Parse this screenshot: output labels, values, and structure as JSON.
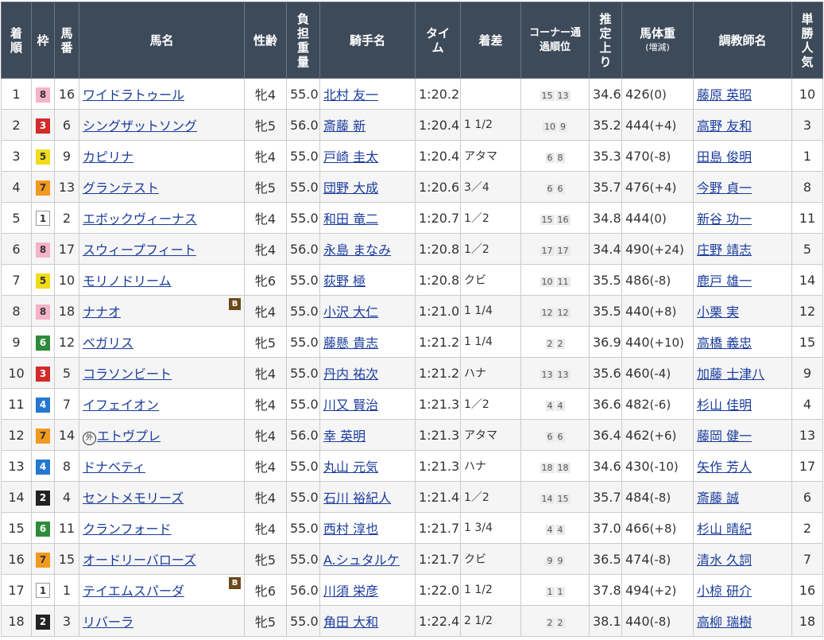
{
  "headers": {
    "rank": "着順",
    "waku": "枠",
    "umaban": "馬番",
    "horse": "馬名",
    "sexage": "性齢",
    "weight": "負担重量",
    "jockey": "騎手名",
    "time": "タイム",
    "margin": "着差",
    "corner": "コーナー通過順位",
    "last3f": "推定上り",
    "bodyweight": "馬体重",
    "bodyweight_sub": "(増減)",
    "trainer": "調教師名",
    "pop": "単勝人気"
  },
  "rows": [
    {
      "rank": "1",
      "waku": "8",
      "umaban": "16",
      "horse": "ワイドラトゥール",
      "blinker": "",
      "foreign": "",
      "sexage": "牝4",
      "weight": "55.0",
      "jockey": "北村 友一",
      "time": "1:20.2",
      "margin": "",
      "c1": "15",
      "c2": "13",
      "last3f": "34.6",
      "bw": "426",
      "diff": "(0)",
      "trainer": "藤原 英昭",
      "pop": "10"
    },
    {
      "rank": "2",
      "waku": "3",
      "umaban": "6",
      "horse": "シングザットソング",
      "blinker": "",
      "foreign": "",
      "sexage": "牝5",
      "weight": "56.0",
      "jockey": "斎藤 新",
      "time": "1:20.4",
      "margin": "1 1/2",
      "c1": "10",
      "c2": "9",
      "last3f": "35.2",
      "bw": "444",
      "diff": "(+4)",
      "trainer": "高野 友和",
      "pop": "3"
    },
    {
      "rank": "3",
      "waku": "5",
      "umaban": "9",
      "horse": "カピリナ",
      "blinker": "",
      "foreign": "",
      "sexage": "牝4",
      "weight": "55.0",
      "jockey": "戸崎 圭太",
      "time": "1:20.4",
      "margin": "アタマ",
      "c1": "6",
      "c2": "8",
      "last3f": "35.3",
      "bw": "470",
      "diff": "(-8)",
      "trainer": "田島 俊明",
      "pop": "1"
    },
    {
      "rank": "4",
      "waku": "7",
      "umaban": "13",
      "horse": "グランテスト",
      "blinker": "",
      "foreign": "",
      "sexage": "牝5",
      "weight": "55.0",
      "jockey": "団野 大成",
      "time": "1:20.6",
      "margin": "3／4",
      "c1": "6",
      "c2": "6",
      "last3f": "35.7",
      "bw": "476",
      "diff": "(+4)",
      "trainer": "今野 貞一",
      "pop": "8"
    },
    {
      "rank": "5",
      "waku": "1",
      "umaban": "2",
      "horse": "エボックヴィーナス",
      "blinker": "",
      "foreign": "",
      "sexage": "牝4",
      "weight": "55.0",
      "jockey": "和田 竜二",
      "time": "1:20.7",
      "margin": "1／2",
      "c1": "15",
      "c2": "16",
      "last3f": "34.8",
      "bw": "444",
      "diff": "(0)",
      "trainer": "新谷 功一",
      "pop": "11"
    },
    {
      "rank": "6",
      "waku": "8",
      "umaban": "17",
      "horse": "スウィープフィート",
      "blinker": "",
      "foreign": "",
      "sexage": "牝4",
      "weight": "56.0",
      "jockey": "永島 まなみ",
      "time": "1:20.8",
      "margin": "1／2",
      "c1": "17",
      "c2": "17",
      "last3f": "34.4",
      "bw": "490",
      "diff": "(+24)",
      "trainer": "庄野 靖志",
      "pop": "5"
    },
    {
      "rank": "7",
      "waku": "5",
      "umaban": "10",
      "horse": "モリノドリーム",
      "blinker": "",
      "foreign": "",
      "sexage": "牝6",
      "weight": "55.0",
      "jockey": "荻野 極",
      "time": "1:20.8",
      "margin": "クビ",
      "c1": "10",
      "c2": "11",
      "last3f": "35.5",
      "bw": "486",
      "diff": "(-8)",
      "trainer": "鹿戸 雄一",
      "pop": "14"
    },
    {
      "rank": "8",
      "waku": "8",
      "umaban": "18",
      "horse": "ナナオ",
      "blinker": "B",
      "foreign": "",
      "sexage": "牝4",
      "weight": "55.0",
      "jockey": "小沢 大仁",
      "time": "1:21.0",
      "margin": "1 1/4",
      "c1": "12",
      "c2": "12",
      "last3f": "35.5",
      "bw": "440",
      "diff": "(+8)",
      "trainer": "小栗 実",
      "pop": "12"
    },
    {
      "rank": "9",
      "waku": "6",
      "umaban": "12",
      "horse": "ベガリス",
      "blinker": "",
      "foreign": "",
      "sexage": "牝5",
      "weight": "55.0",
      "jockey": "藤懸 貴志",
      "time": "1:21.2",
      "margin": "1 1/4",
      "c1": "2",
      "c2": "2",
      "last3f": "36.9",
      "bw": "440",
      "diff": "(+10)",
      "trainer": "高橋 義忠",
      "pop": "15"
    },
    {
      "rank": "10",
      "waku": "3",
      "umaban": "5",
      "horse": "コラソンビート",
      "blinker": "",
      "foreign": "",
      "sexage": "牝4",
      "weight": "55.0",
      "jockey": "丹内 祐次",
      "time": "1:21.2",
      "margin": "ハナ",
      "c1": "13",
      "c2": "13",
      "last3f": "35.6",
      "bw": "460",
      "diff": "(-4)",
      "trainer": "加藤 士津八",
      "pop": "9"
    },
    {
      "rank": "11",
      "waku": "4",
      "umaban": "7",
      "horse": "イフェイオン",
      "blinker": "",
      "foreign": "",
      "sexage": "牝4",
      "weight": "55.0",
      "jockey": "川又 賢治",
      "time": "1:21.3",
      "margin": "1／2",
      "c1": "4",
      "c2": "4",
      "last3f": "36.6",
      "bw": "482",
      "diff": "(-6)",
      "trainer": "杉山 佳明",
      "pop": "4"
    },
    {
      "rank": "12",
      "waku": "7",
      "umaban": "14",
      "horse": "エトヴプレ",
      "blinker": "",
      "foreign": "外",
      "sexage": "牝4",
      "weight": "56.0",
      "jockey": "幸 英明",
      "time": "1:21.3",
      "margin": "アタマ",
      "c1": "6",
      "c2": "6",
      "last3f": "36.4",
      "bw": "462",
      "diff": "(+6)",
      "trainer": "藤岡 健一",
      "pop": "13"
    },
    {
      "rank": "13",
      "waku": "4",
      "umaban": "8",
      "horse": "ドナベティ",
      "blinker": "",
      "foreign": "",
      "sexage": "牝4",
      "weight": "55.0",
      "jockey": "丸山 元気",
      "time": "1:21.3",
      "margin": "ハナ",
      "c1": "18",
      "c2": "18",
      "last3f": "34.6",
      "bw": "430",
      "diff": "(-10)",
      "trainer": "矢作 芳人",
      "pop": "17"
    },
    {
      "rank": "14",
      "waku": "2",
      "umaban": "4",
      "horse": "セントメモリーズ",
      "blinker": "",
      "foreign": "",
      "sexage": "牝4",
      "weight": "55.0",
      "jockey": "石川 裕紀人",
      "time": "1:21.4",
      "margin": "1／2",
      "c1": "14",
      "c2": "15",
      "last3f": "35.7",
      "bw": "484",
      "diff": "(-8)",
      "trainer": "斎藤 誠",
      "pop": "6"
    },
    {
      "rank": "15",
      "waku": "6",
      "umaban": "11",
      "horse": "クランフォード",
      "blinker": "",
      "foreign": "",
      "sexage": "牝4",
      "weight": "55.0",
      "jockey": "西村 淳也",
      "time": "1:21.7",
      "margin": "1 3/4",
      "c1": "4",
      "c2": "4",
      "last3f": "37.0",
      "bw": "466",
      "diff": "(+8)",
      "trainer": "杉山 晴紀",
      "pop": "2"
    },
    {
      "rank": "16",
      "waku": "7",
      "umaban": "15",
      "horse": "オードリーバローズ",
      "blinker": "",
      "foreign": "",
      "sexage": "牝5",
      "weight": "55.0",
      "jockey": "A.シュタルケ",
      "time": "1:21.7",
      "margin": "クビ",
      "c1": "9",
      "c2": "9",
      "last3f": "36.5",
      "bw": "474",
      "diff": "(-8)",
      "trainer": "清水 久詞",
      "pop": "7"
    },
    {
      "rank": "17",
      "waku": "1",
      "umaban": "1",
      "horse": "テイエムスパーダ",
      "blinker": "B",
      "foreign": "",
      "sexage": "牝6",
      "weight": "56.0",
      "jockey": "川須 栄彦",
      "time": "1:22.0",
      "margin": "1 1/2",
      "c1": "1",
      "c2": "1",
      "last3f": "37.8",
      "bw": "494",
      "diff": "(+2)",
      "trainer": "小椋 研介",
      "pop": "16"
    },
    {
      "rank": "18",
      "waku": "2",
      "umaban": "3",
      "horse": "リバーラ",
      "blinker": "",
      "foreign": "",
      "sexage": "牝5",
      "weight": "55.0",
      "jockey": "角田 大和",
      "time": "1:22.4",
      "margin": "2 1/2",
      "c1": "2",
      "c2": "2",
      "last3f": "38.1",
      "bw": "440",
      "diff": "(-8)",
      "trainer": "高柳 瑞樹",
      "pop": "18"
    }
  ]
}
